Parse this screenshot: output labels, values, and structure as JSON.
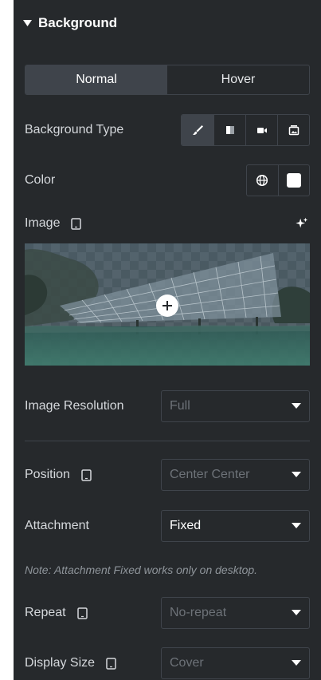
{
  "section": {
    "title": "Background"
  },
  "tabs": [
    {
      "label": "Normal",
      "active": true
    },
    {
      "label": "Hover",
      "active": false
    }
  ],
  "background_type": {
    "label": "Background Type",
    "options": [
      {
        "icon": "paint-brush-icon",
        "active": true
      },
      {
        "icon": "gradient-icon",
        "active": false
      },
      {
        "icon": "video-icon",
        "active": false
      },
      {
        "icon": "slideshow-icon",
        "active": false
      }
    ]
  },
  "color": {
    "label": "Color",
    "swatch": "#ffffff",
    "global_icon": "globe-icon"
  },
  "image": {
    "label": "Image",
    "responsive_icon": "tablet-icon",
    "ai_icon": "ai-sparkle-icon"
  },
  "image_resolution": {
    "label": "Image Resolution",
    "value": "Full"
  },
  "position": {
    "label": "Position",
    "value": "Center Center"
  },
  "attachment": {
    "label": "Attachment",
    "value": "Fixed"
  },
  "note": "Note: Attachment Fixed works only on desktop.",
  "repeat": {
    "label": "Repeat",
    "value": "No-repeat"
  },
  "display_size": {
    "label": "Display Size",
    "value": "Cover"
  },
  "colors": {
    "panel": "#26292c",
    "border": "#3f444b",
    "text": "#d5d8dc",
    "muted": "#6d7278"
  }
}
